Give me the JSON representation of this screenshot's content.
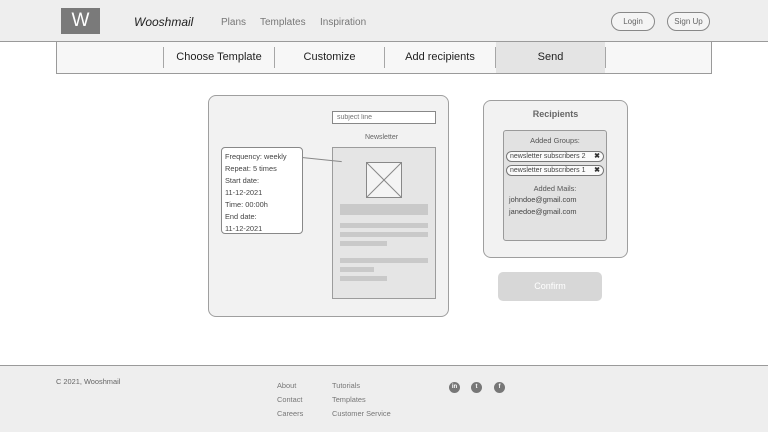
{
  "header": {
    "logo_letter": "W",
    "brand": "Wooshmail",
    "nav": [
      "Plans",
      "Templates",
      "Inspiration"
    ],
    "login_label": "Login",
    "signup_label": "Sign Up"
  },
  "steps": [
    "Choose Template",
    "Customize",
    "Add recipients",
    "Send"
  ],
  "active_step": "Send",
  "editor": {
    "subject_placeholder": "subject line",
    "newsletter_title": "Newsletter",
    "schedule": [
      "Frequency: weekly",
      "Repeat: 5 times",
      "Start date:",
      "11-12-2021",
      "Time: 00:00h",
      "End date:",
      "11-12-2021"
    ]
  },
  "recipients": {
    "title": "Recipients",
    "groups_label": "Added Groups:",
    "groups": [
      "newsletter subscribers 2",
      "newsletter subscribers 1"
    ],
    "remove_glyph": "✖",
    "mails_label": "Added Mails:",
    "mails": [
      "johndoe@gmail.com",
      "janedoe@gmail.com"
    ]
  },
  "confirm_label": "Confirm",
  "footer": {
    "copyright": "C 2021, Wooshmail",
    "col1": [
      "About",
      "Contact",
      "Careers"
    ],
    "col2": [
      "Tutorials",
      "Templates",
      "Customer Service"
    ],
    "social_icons": [
      "linkedin-icon",
      "twitter-icon",
      "facebook-icon"
    ],
    "social_glyphs": [
      "in",
      "t",
      "f"
    ]
  }
}
